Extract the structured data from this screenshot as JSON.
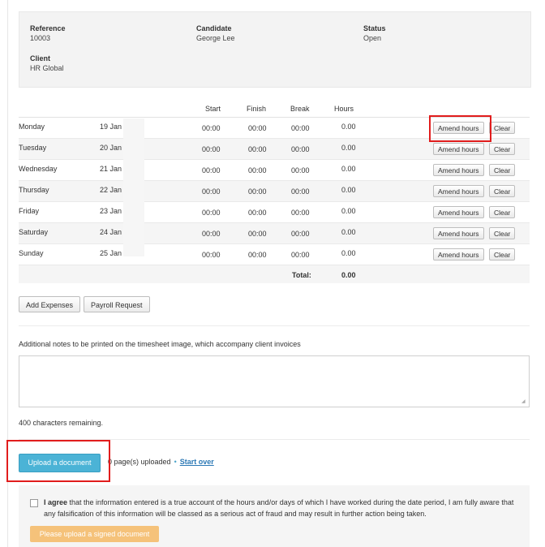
{
  "info": {
    "reference_label": "Reference",
    "reference_value": "10003",
    "candidate_label": "Candidate",
    "candidate_value": "George Lee",
    "status_label": "Status",
    "status_value": "Open",
    "client_label": "Client",
    "client_value": "HR Global"
  },
  "table": {
    "headers": {
      "start": "Start",
      "finish": "Finish",
      "break": "Break",
      "hours": "Hours"
    },
    "rows": [
      {
        "day": "Monday",
        "date": "19 Jan",
        "start": "00:00",
        "finish": "00:00",
        "break": "00:00",
        "hours": "0.00"
      },
      {
        "day": "Tuesday",
        "date": "20 Jan",
        "start": "00:00",
        "finish": "00:00",
        "break": "00:00",
        "hours": "0.00"
      },
      {
        "day": "Wednesday",
        "date": "21 Jan",
        "start": "00:00",
        "finish": "00:00",
        "break": "00:00",
        "hours": "0.00"
      },
      {
        "day": "Thursday",
        "date": "22 Jan",
        "start": "00:00",
        "finish": "00:00",
        "break": "00:00",
        "hours": "0.00"
      },
      {
        "day": "Friday",
        "date": "23 Jan",
        "start": "00:00",
        "finish": "00:00",
        "break": "00:00",
        "hours": "0.00"
      },
      {
        "day": "Saturday",
        "date": "24 Jan",
        "start": "00:00",
        "finish": "00:00",
        "break": "00:00",
        "hours": "0.00"
      },
      {
        "day": "Sunday",
        "date": "25 Jan",
        "start": "00:00",
        "finish": "00:00",
        "break": "00:00",
        "hours": "0.00"
      }
    ],
    "amend_label": "Amend hours",
    "clear_label": "Clear",
    "total_label": "Total:",
    "total_value": "0.00"
  },
  "actions": {
    "add_expenses": "Add Expenses",
    "payroll_request": "Payroll Request"
  },
  "notes": {
    "label": "Additional notes to be printed on the timesheet image, which accompany client invoices",
    "value": "",
    "remaining": "400 characters remaining."
  },
  "upload": {
    "button": "Upload a document",
    "status": "0 page(s) uploaded",
    "separator": "•",
    "start_over": "Start over"
  },
  "agreement": {
    "bold": "I agree",
    "text": " that the information entered is a true account of the hours and/or days of which I have worked during the date period, I am fully aware that any falsification of this information will be classed as a serious act of fraud and may result in further action being taken.",
    "signed_button": "Please upload a signed document"
  },
  "colors": {
    "upload_button": "#4bb3d6",
    "signed_button": "#f5c27a",
    "highlight": "#e11d1d",
    "link": "#2b78b5"
  }
}
